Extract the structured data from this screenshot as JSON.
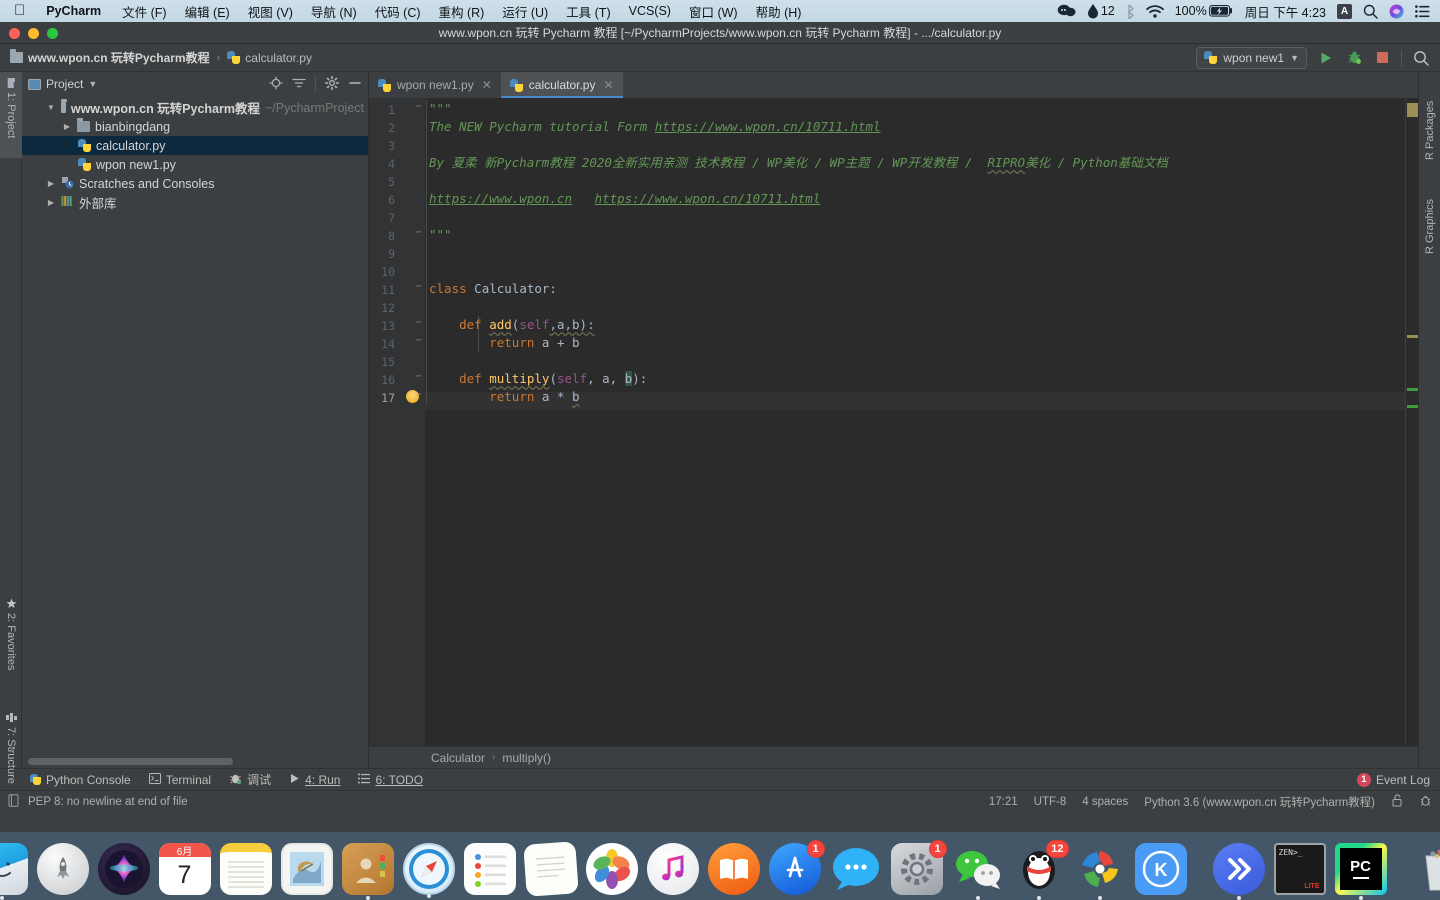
{
  "macmenu": {
    "apple_icon": "apple-icon",
    "app_name": "PyCharm",
    "items": [
      "文件 (F)",
      "编辑 (E)",
      "视图 (V)",
      "导航 (N)",
      "代码 (C)",
      "重构 (R)",
      "运行 (U)",
      "工具 (T)",
      "VCS(S)",
      "窗口 (W)",
      "帮助 (H)"
    ],
    "status": {
      "messages_icon": "chat-bubbles-icon",
      "dropbox_icon": "dropbox-icon",
      "dropbox_count": "12",
      "bluetooth_icon": "bluetooth-icon",
      "wifi_icon": "wifi-icon",
      "battery_percent": "100%",
      "battery_icon": "battery-charging-icon",
      "clock": "周日 下午 4:23",
      "input_source": "A",
      "search_icon": "search-icon",
      "siri_icon": "siri-icon",
      "control_center_icon": "list-icon"
    }
  },
  "window": {
    "title": "www.wpon.cn 玩转 Pycharm 教程 [~/PycharmProjects/www.wpon.cn 玩转 Pycharm 教程] - .../calculator.py"
  },
  "navbar": {
    "project_crumb": "www.wpon.cn 玩转Pycharm教程",
    "file_crumb": "calculator.py",
    "separator": "›",
    "run_config": "wpon new1",
    "dropdown_icon": "chevron-down-icon",
    "run_icon": "run-icon",
    "debug_icon": "debug-icon",
    "stop_icon": "stop-icon",
    "search_icon": "search-everywhere-icon"
  },
  "left_strip": [
    {
      "label": "1: Project",
      "icon": "project-folder-icon",
      "selected": true
    },
    {
      "label": "2: Favorites",
      "icon": "star-icon",
      "selected": false
    },
    {
      "label": "7: Structure",
      "icon": "structure-icon",
      "selected": false
    }
  ],
  "right_strip": [
    {
      "label": "R Packages",
      "selected": false
    },
    {
      "label": "R Graphics",
      "selected": false
    }
  ],
  "project_panel": {
    "title": "Project",
    "dropdown_icon": "chevron-down-icon",
    "locate_icon": "target-icon",
    "collapse_icon": "collapse-all-icon",
    "settings_icon": "gear-icon",
    "hide_icon": "minimize-icon",
    "tree": [
      {
        "label": "www.wpon.cn 玩转Pycharm教程",
        "suffix": "~/PycharmProject",
        "icon": "folder-icon",
        "indent": 0,
        "arrow": "▼",
        "bold": true,
        "selected": false
      },
      {
        "label": "bianbingdang",
        "suffix": "",
        "icon": "folder-icon",
        "indent": 1,
        "arrow": "▶",
        "bold": false,
        "selected": false
      },
      {
        "label": "calculator.py",
        "suffix": "",
        "icon": "python-file-icon",
        "indent": 2,
        "arrow": "",
        "bold": false,
        "selected": true
      },
      {
        "label": "wpon new1.py",
        "suffix": "",
        "icon": "python-file-icon",
        "indent": 2,
        "arrow": "",
        "bold": false,
        "selected": false
      },
      {
        "label": "Scratches and Consoles",
        "suffix": "",
        "icon": "scratches-icon",
        "indent": 0,
        "arrow": "▶",
        "bold": false,
        "selected": false
      },
      {
        "label": "外部库",
        "suffix": "",
        "icon": "external-libraries-icon",
        "indent": 0,
        "arrow": "▶",
        "bold": false,
        "selected": false
      }
    ]
  },
  "editor": {
    "tabs": [
      {
        "label": "wpon new1.py",
        "icon": "python-file-icon",
        "active": false,
        "close_icon": "close-icon"
      },
      {
        "label": "calculator.py",
        "icon": "python-file-icon",
        "active": true,
        "close_icon": "close-icon"
      }
    ],
    "line_numbers": [
      "1",
      "2",
      "3",
      "4",
      "5",
      "6",
      "7",
      "8",
      "9",
      "10",
      "11",
      "12",
      "13",
      "14",
      "15",
      "16",
      "17"
    ],
    "current_line": 17,
    "lines": [
      {
        "n": 1,
        "text": "\"\"\""
      },
      {
        "n": 2,
        "text": "The NEW Pycharm tutorial Form https://www.wpon.cn/10711.html"
      },
      {
        "n": 3,
        "text": ""
      },
      {
        "n": 4,
        "text": "By 夏柔 新Pycharm教程 2020全新实用亲测 技术教程 / WP美化 / WP主题 / WP开发教程 /  RIPRO美化 / Python基础文档"
      },
      {
        "n": 5,
        "text": ""
      },
      {
        "n": 6,
        "text": "https://www.wpon.cn   https://www.wpon.cn/10711.html"
      },
      {
        "n": 7,
        "text": ""
      },
      {
        "n": 8,
        "text": "\"\"\""
      },
      {
        "n": 9,
        "text": ""
      },
      {
        "n": 10,
        "text": ""
      },
      {
        "n": 11,
        "text": "class Calculator:"
      },
      {
        "n": 12,
        "text": ""
      },
      {
        "n": 13,
        "text": "    def add(self,a,b):"
      },
      {
        "n": 14,
        "text": "        return a + b"
      },
      {
        "n": 15,
        "text": ""
      },
      {
        "n": 16,
        "text": "    def multiply(self, a, b):"
      },
      {
        "n": 17,
        "text": "        return a * b"
      }
    ],
    "tokens": {
      "docstring_quote": "\"\"\"",
      "l2_a": "The NEW Pycharm tutorial Form ",
      "l2_link": "https://www.wpon.cn/10711.html",
      "l4_a": "By 夏柔 新Pycharm教程 2020全新实用亲测 技术教程 / WP美化 / WP主题 / WP开发教程 /  ",
      "l4_b": "RIPRO",
      "l4_c": "美化 / Python基础文档",
      "l6_link1": "https://www.wpon.cn",
      "l6_link2": "https://www.wpon.cn/10711.html",
      "kw_class": "class",
      "class_name": "Calculator:",
      "kw_def": "def",
      "fn_add": "add",
      "fn_multiply": "multiply",
      "self": "self",
      "kw_return": "return",
      "add_sig_rest": ",a,b):",
      "add_body": "a + b",
      "mul_sig_mid": ", a, ",
      "mul_sig_b": "b",
      "mul_sig_end": "):",
      "mul_body_a": "a * ",
      "mul_body_b": "b"
    },
    "bulb_icon": "intention-bulb-icon"
  },
  "breadcrumb": {
    "class": "Calculator",
    "separator": "›",
    "method": "multiply()"
  },
  "bottom_bar": {
    "items": [
      {
        "label": "Python Console",
        "icon": "python-console-icon"
      },
      {
        "label": "Terminal",
        "icon": "terminal-icon"
      },
      {
        "label": "调试",
        "icon": "debug-icon"
      },
      {
        "label": "4: Run",
        "icon": "run-icon"
      },
      {
        "label": "6: TODO",
        "icon": "todo-icon"
      }
    ],
    "event_log": "Event Log",
    "event_log_count": "1"
  },
  "status_bar": {
    "inspection_icon": "inspection-icon",
    "message": "PEP 8: no newline at end of file",
    "caret": "17:21",
    "encoding": "UTF-8",
    "indent": "4 spaces",
    "interpreter": "Python 3.6 (www.wpon.cn 玩转Pycharm教程)",
    "lock_icon": "unlocked-icon",
    "bug_icon": "bug-icon"
  },
  "dock": {
    "items": [
      {
        "name": "finder",
        "glyph": "",
        "running": true,
        "badge": ""
      },
      {
        "name": "launchpad",
        "glyph": "",
        "running": false,
        "badge": ""
      },
      {
        "name": "siri",
        "glyph": "",
        "running": false,
        "badge": ""
      },
      {
        "name": "calendar",
        "glyph": "7",
        "running": false,
        "badge": "",
        "caption": "6月"
      },
      {
        "name": "notes",
        "glyph": "",
        "running": false,
        "badge": ""
      },
      {
        "name": "mail",
        "glyph": "",
        "running": false,
        "badge": ""
      },
      {
        "name": "contacts",
        "glyph": "",
        "running": false,
        "badge": ""
      },
      {
        "name": "safari",
        "glyph": "",
        "running": true,
        "badge": ""
      },
      {
        "name": "reminders",
        "glyph": "",
        "running": false,
        "badge": ""
      },
      {
        "name": "pages",
        "glyph": "",
        "running": false,
        "badge": ""
      },
      {
        "name": "photos",
        "glyph": "",
        "running": false,
        "badge": ""
      },
      {
        "name": "itunes",
        "glyph": "",
        "running": false,
        "badge": ""
      },
      {
        "name": "ibooks",
        "glyph": "",
        "running": false,
        "badge": ""
      },
      {
        "name": "app-store",
        "glyph": "",
        "running": false,
        "badge": "1"
      },
      {
        "name": "messages",
        "glyph": "",
        "running": false,
        "badge": ""
      },
      {
        "name": "system-preferences",
        "glyph": "",
        "running": false,
        "badge": "1"
      },
      {
        "name": "wechat",
        "glyph": "",
        "running": true,
        "badge": ""
      },
      {
        "name": "qq",
        "glyph": "",
        "running": true,
        "badge": "12"
      },
      {
        "name": "google-drive",
        "glyph": "",
        "running": true,
        "badge": ""
      },
      {
        "name": "keka",
        "glyph": "K",
        "running": false,
        "badge": ""
      },
      {
        "name": "separator-1",
        "glyph": "",
        "running": false,
        "badge": ""
      },
      {
        "name": "remote-desktop",
        "glyph": "",
        "running": true,
        "badge": ""
      },
      {
        "name": "iterm",
        "glyph": "ZEN>_",
        "running": true,
        "badge": ""
      },
      {
        "name": "pycharm",
        "glyph": "PC",
        "running": true,
        "badge": ""
      },
      {
        "name": "separator-2",
        "glyph": "",
        "running": false,
        "badge": ""
      },
      {
        "name": "trash",
        "glyph": "",
        "running": false,
        "badge": ""
      }
    ]
  }
}
